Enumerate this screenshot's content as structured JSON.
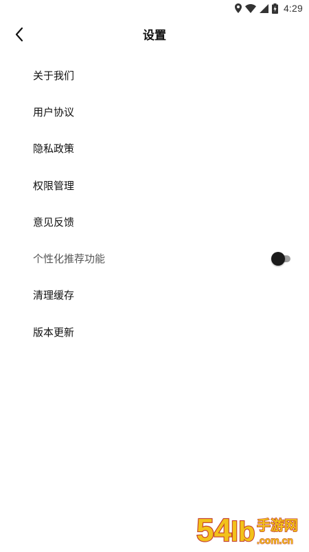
{
  "status_bar": {
    "time": "4:29",
    "icons": [
      "location-icon",
      "wifi-icon",
      "signal-icon",
      "battery-charging-icon"
    ]
  },
  "header": {
    "title": "设置",
    "back_icon": "chevron-left-icon"
  },
  "settings": {
    "items": [
      {
        "label": "关于我们"
      },
      {
        "label": "用户协议"
      },
      {
        "label": "隐私政策"
      },
      {
        "label": "权限管理"
      },
      {
        "label": "意见反馈"
      },
      {
        "label": "个性化推荐功能",
        "toggle": {
          "on": false
        }
      },
      {
        "label": "清理缓存"
      },
      {
        "label": "版本更新"
      }
    ]
  },
  "watermark": {
    "brand": "54lb手游网",
    "domain": ".com.cn"
  },
  "colors": {
    "background": "#ffffff",
    "text_primary": "#111111",
    "text_muted": "#555555",
    "toggle_thumb_off": "#1a1a1a",
    "toggle_track_off": "#9e9e9e",
    "watermark_fill": "#f2c21b",
    "watermark_outline": "#c0392b"
  }
}
